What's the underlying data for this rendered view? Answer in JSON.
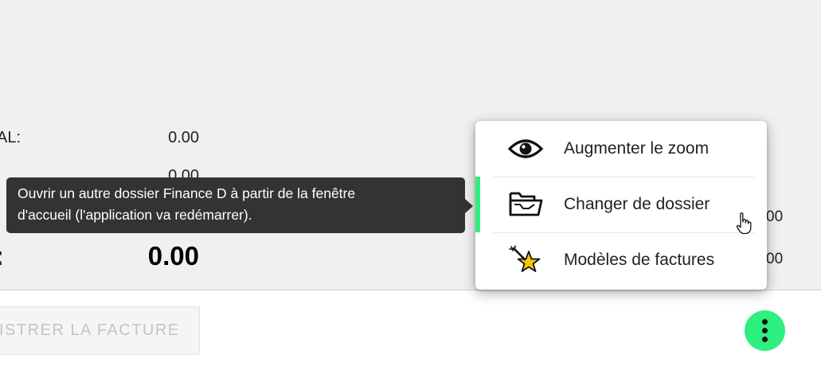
{
  "summary": {
    "total_label": "AL:",
    "total_value": "0.00",
    "second_value": "0.00",
    "big_label": ":",
    "big_value": "0.00",
    "right_value_1": "00",
    "right_value_2": "00"
  },
  "footer": {
    "save_button_label": "ISTRER LA FACTURE"
  },
  "tooltip": {
    "text_line1": "Ouvrir un autre dossier Finance D à partir de la fenêtre",
    "text_line2": "d'accueil (l'application va redémarrer)."
  },
  "menu": {
    "items": [
      {
        "label": "Augmenter le zoom",
        "icon": "eye-icon"
      },
      {
        "label": "Changer de dossier",
        "icon": "open-folder-icon",
        "highlighted": true
      },
      {
        "label": "Modèles de factures",
        "icon": "star-wand-icon"
      }
    ]
  },
  "colors": {
    "accent": "#2ef07f",
    "tooltip_bg": "#333333",
    "background": "#f0f0f0"
  }
}
